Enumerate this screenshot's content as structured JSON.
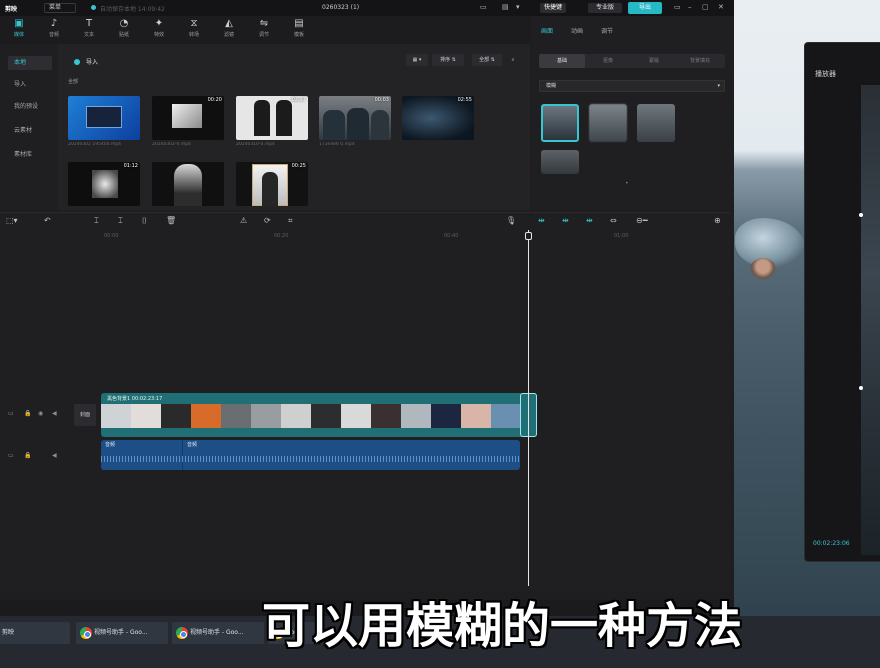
{
  "titlebar": {
    "logo": "剪映",
    "menu": "菜单",
    "autosave": "自动保存本地 14:09:42",
    "project_title": "0260323 (1)",
    "shortcut": "快捷键",
    "pro": "专业版",
    "export": "导出"
  },
  "toolbar": {
    "tools": [
      {
        "label": "媒体",
        "icon": "▣"
      },
      {
        "label": "音频",
        "icon": "♪"
      },
      {
        "label": "文本",
        "icon": "T"
      },
      {
        "label": "贴纸",
        "icon": "◔"
      },
      {
        "label": "特效",
        "icon": "✦"
      },
      {
        "label": "转场",
        "icon": "⧖"
      },
      {
        "label": "滤镜",
        "icon": "◭"
      },
      {
        "label": "调节",
        "icon": "⇋"
      },
      {
        "label": "模板",
        "icon": "▤"
      }
    ]
  },
  "media": {
    "sidebar": [
      "本地",
      "导入",
      "我的预设",
      "云素材",
      "素材库"
    ],
    "import_label": "导入",
    "all_label": "全部",
    "tools": {
      "view": "▦ ▾",
      "sort": "排序 ⇅",
      "filter": "全部 ⇅",
      "search": "⌕"
    },
    "thumbs": [
      {
        "name": "20240302 195404.mp4",
        "duration": ""
      },
      {
        "name": "20240302-0.mp4",
        "duration": "00:20"
      },
      {
        "name": "",
        "duration": "02:27"
      },
      {
        "name": "20240310-0.mp4",
        "duration": "00:03"
      },
      {
        "name": "173e4e6 0.mp4",
        "duration": ""
      },
      {
        "name": "",
        "duration": "02:55"
      },
      {
        "name": "",
        "duration": "01:12"
      },
      {
        "name": "",
        "duration": ""
      },
      {
        "name": "",
        "duration": "00:25"
      }
    ]
  },
  "props": {
    "tabs": [
      "画面",
      "动画",
      "调节"
    ],
    "segments": [
      "基础",
      "抠像",
      "蒙版",
      "背景填充"
    ],
    "select_value": "模糊"
  },
  "timeline": {
    "ticks": [
      "00:00",
      "00:20",
      "00:40",
      "01:00"
    ],
    "cover_label": "封面",
    "clip_label": "黑色背景1 00:02:23:17",
    "audio_labels": [
      "音频",
      "音频"
    ]
  },
  "side_window": {
    "title": "播放器",
    "time": "00:02:23:06"
  },
  "taskbar": {
    "tasks": [
      "剪映",
      "视频号助手 - Goo...",
      "视频号助手 - Goo...",
      "Goo..."
    ]
  },
  "subtitle": "可以用模糊的一种方法"
}
